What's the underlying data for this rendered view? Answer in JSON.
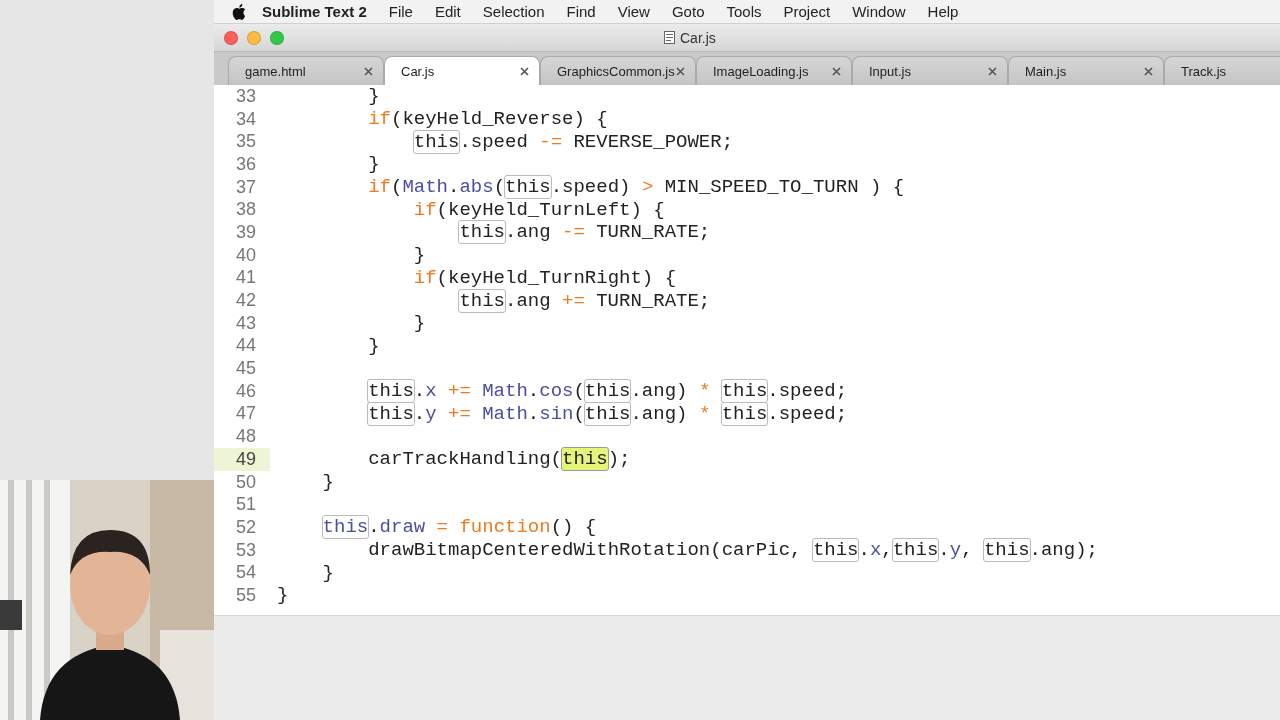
{
  "menu_bar": {
    "app": "Sublime Text 2",
    "items": [
      "File",
      "Edit",
      "Selection",
      "Find",
      "View",
      "Goto",
      "Tools",
      "Project",
      "Window",
      "Help"
    ]
  },
  "window": {
    "title": "Car.js"
  },
  "tabs": [
    {
      "label": "game.html",
      "selected": false,
      "closable": true
    },
    {
      "label": "Car.js",
      "selected": true,
      "closable": true
    },
    {
      "label": "GraphicsCommon.js",
      "selected": false,
      "closable": true
    },
    {
      "label": "ImageLoading.js",
      "selected": false,
      "closable": true
    },
    {
      "label": "Input.js",
      "selected": false,
      "closable": true
    },
    {
      "label": "Main.js",
      "selected": false,
      "closable": true
    },
    {
      "label": "Track.js",
      "selected": false
    }
  ],
  "editor": {
    "lines": [
      {
        "children": [
          {
            "children": [
              {
                "number": "33",
                "current": false,
                "tokens": [
                  {
                    "kind": "plain",
                    "text": "}"
                  }
                ]
              },
              {
                "number": "34",
                "current": false,
                "tokens": [
                  {
                    "kind": "keyword",
                    "text": "if"
                  },
                  {
                    "kind": "plain",
                    "text": "(keyHeld_Reverse) {"
                  }
                ],
                "children": [
                  {
                    "number": "35",
                    "current": false,
                    "tokens": [
                      {
                        "kind": "this",
                        "text": "this"
                      },
                      {
                        "kind": "plain",
                        "text": ".speed"
                      },
                      {
                        "kind": "keyword",
                        "text": " -= "
                      },
                      {
                        "kind": "plain",
                        "text": "REVERSE_POWER;"
                      }
                    ]
                  }
                ]
              },
              {
                "number": "36",
                "current": false,
                "tokens": [
                  {
                    "kind": "plain",
                    "text": "}"
                  }
                ]
              },
              {
                "number": "37",
                "current": false,
                "tokens": [
                  {
                    "kind": "keyword",
                    "text": "if"
                  },
                  {
                    "kind": "plain",
                    "text": "("
                  },
                  {
                    "kind": "builtin",
                    "text": "Math"
                  },
                  {
                    "kind": "plain",
                    "text": "."
                  },
                  {
                    "kind": "builtin",
                    "text": "abs"
                  },
                  {
                    "kind": "plain",
                    "text": "("
                  },
                  {
                    "kind": "this",
                    "text": "this"
                  },
                  {
                    "kind": "plain",
                    "text": ".speed)"
                  },
                  {
                    "kind": "keyword",
                    "text": " > "
                  },
                  {
                    "kind": "plain",
                    "text": "MIN_SPEED_TO_TURN ) {"
                  }
                ],
                "children": [
                  {
                    "number": "38",
                    "current": false,
                    "tokens": [
                      {
                        "kind": "keyword",
                        "text": "if"
                      },
                      {
                        "kind": "plain",
                        "text": "(keyHeld_TurnLeft) {"
                      }
                    ],
                    "children": [
                      {
                        "number": "39",
                        "current": false,
                        "tokens": [
                          {
                            "kind": "this",
                            "text": "this"
                          },
                          {
                            "kind": "plain",
                            "text": ".ang"
                          },
                          {
                            "kind": "keyword",
                            "text": " -= "
                          },
                          {
                            "kind": "plain",
                            "text": "TURN_RATE;"
                          }
                        ]
                      }
                    ]
                  },
                  {
                    "number": "40",
                    "current": false,
                    "tokens": [
                      {
                        "kind": "plain",
                        "text": "}"
                      }
                    ]
                  },
                  {
                    "number": "41",
                    "current": false,
                    "tokens": [
                      {
                        "kind": "keyword",
                        "text": "if"
                      },
                      {
                        "kind": "plain",
                        "text": "(keyHeld_TurnRight) {"
                      }
                    ],
                    "children": [
                      {
                        "number": "42",
                        "current": false,
                        "tokens": [
                          {
                            "kind": "this",
                            "text": "this"
                          },
                          {
                            "kind": "plain",
                            "text": ".ang"
                          },
                          {
                            "kind": "keyword",
                            "text": " += "
                          },
                          {
                            "kind": "plain",
                            "text": "TURN_RATE;"
                          }
                        ]
                      }
                    ]
                  },
                  {
                    "number": "43",
                    "current": false,
                    "tokens": [
                      {
                        "kind": "plain",
                        "text": "}"
                      }
                    ]
                  }
                ]
              },
              {
                "number": "44",
                "current": false,
                "tokens": [
                  {
                    "kind": "plain",
                    "text": "}"
                  }
                ]
              },
              {
                "number": "45",
                "current": false
              },
              {
                "number": "46",
                "current": false,
                "tokens": [
                  {
                    "kind": "this",
                    "text": "this"
                  },
                  {
                    "kind": "plain",
                    "text": "."
                  },
                  {
                    "kind": "builtin",
                    "text": "x"
                  },
                  {
                    "kind": "keyword",
                    "text": " += "
                  },
                  {
                    "kind": "builtin",
                    "text": "Math"
                  },
                  {
                    "kind": "plain",
                    "text": "."
                  },
                  {
                    "kind": "builtin",
                    "text": "cos"
                  },
                  {
                    "kind": "plain",
                    "text": "("
                  },
                  {
                    "kind": "this",
                    "text": "this"
                  },
                  {
                    "kind": "plain",
                    "text": ".ang)"
                  },
                  {
                    "kind": "keyword",
                    "text": " * "
                  },
                  {
                    "kind": "this",
                    "text": "this"
                  },
                  {
                    "kind": "plain",
                    "text": ".speed;"
                  }
                ]
              },
              {
                "number": "47",
                "current": false,
                "tokens": [
                  {
                    "kind": "this",
                    "text": "this"
                  },
                  {
                    "kind": "plain",
                    "text": "."
                  },
                  {
                    "kind": "builtin",
                    "text": "y"
                  },
                  {
                    "kind": "keyword",
                    "text": " += "
                  },
                  {
                    "kind": "builtin",
                    "text": "Math"
                  },
                  {
                    "kind": "plain",
                    "text": "."
                  },
                  {
                    "kind": "builtin",
                    "text": "sin"
                  },
                  {
                    "kind": "plain",
                    "text": "("
                  },
                  {
                    "kind": "this",
                    "text": "this"
                  },
                  {
                    "kind": "plain",
                    "text": ".ang)"
                  },
                  {
                    "kind": "keyword",
                    "text": " * "
                  },
                  {
                    "kind": "this",
                    "text": "this"
                  },
                  {
                    "kind": "plain",
                    "text": ".speed;"
                  }
                ]
              },
              {
                "number": "48",
                "current": false
              },
              {
                "number": "49",
                "current": true,
                "tokens": [
                  {
                    "kind": "plain",
                    "text": "carTrackHandling("
                  },
                  {
                    "kind": "match",
                    "text": "this"
                  },
                  {
                    "kind": "plain",
                    "text": ");"
                  }
                ]
              }
            ]
          },
          {
            "number": "50",
            "current": false,
            "tokens": [
              {
                "kind": "plain",
                "text": "}"
              }
            ]
          },
          {
            "number": "51",
            "current": false
          },
          {
            "number": "52",
            "current": false,
            "tokens": [
              {
                "kind": "this-builtin",
                "text": "this"
              },
              {
                "kind": "plain",
                "text": "."
              },
              {
                "kind": "builtin",
                "text": "draw"
              },
              {
                "kind": "keyword",
                "text": " = "
              },
              {
                "kind": "keyword",
                "text": "function"
              },
              {
                "kind": "plain",
                "text": "() {"
              }
            ],
            "children": [
              {
                "number": "53",
                "current": false,
                "tokens": [
                  {
                    "kind": "plain",
                    "text": "drawBitmapCenteredWithRotation(carPic, "
                  },
                  {
                    "kind": "this",
                    "text": "this"
                  },
                  {
                    "kind": "plain",
                    "text": "."
                  },
                  {
                    "kind": "builtin",
                    "text": "x"
                  },
                  {
                    "kind": "plain",
                    "text": ","
                  },
                  {
                    "kind": "this",
                    "text": "this"
                  },
                  {
                    "kind": "plain",
                    "text": "."
                  },
                  {
                    "kind": "builtin",
                    "text": "y"
                  },
                  {
                    "kind": "plain",
                    "text": ", "
                  },
                  {
                    "kind": "this",
                    "text": "this"
                  },
                  {
                    "kind": "plain",
                    "text": ".ang);"
                  }
                ]
              }
            ]
          },
          {
            "number": "54",
            "current": false,
            "tokens": [
              {
                "kind": "plain",
                "text": "}"
              }
            ]
          }
        ]
      },
      {
        "number": "55",
        "current": false,
        "tokens": [
          {
            "kind": "plain",
            "text": "}"
          }
        ]
      }
    ]
  }
}
